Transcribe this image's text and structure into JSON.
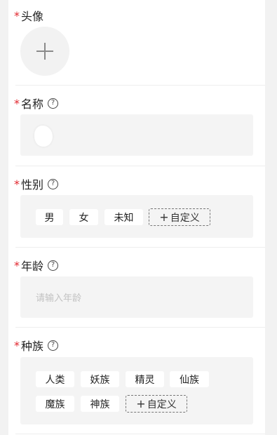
{
  "avatar": {
    "label": "头像",
    "required_mark": "*",
    "add_icon": "plus-icon"
  },
  "name": {
    "label": "名称",
    "required_mark": "*",
    "help_icon": "question-circle-icon",
    "help_glyph": "?"
  },
  "gender": {
    "label": "性别",
    "required_mark": "*",
    "help_glyph": "?",
    "options": [
      "男",
      "女",
      "未知"
    ],
    "custom_label": "自定义",
    "custom_plus": "+"
  },
  "age": {
    "label": "年龄",
    "required_mark": "*",
    "help_glyph": "?",
    "placeholder": "请输入年龄"
  },
  "race": {
    "label": "种族",
    "required_mark": "*",
    "help_glyph": "?",
    "options": [
      "人类",
      "妖族",
      "精灵",
      "仙族",
      "魔族",
      "神族"
    ],
    "custom_label": "自定义",
    "custom_plus": "+"
  },
  "colors": {
    "required": "#e2262e",
    "field_bg": "#f4f4f4",
    "page_bg": "#f2f2f2"
  }
}
